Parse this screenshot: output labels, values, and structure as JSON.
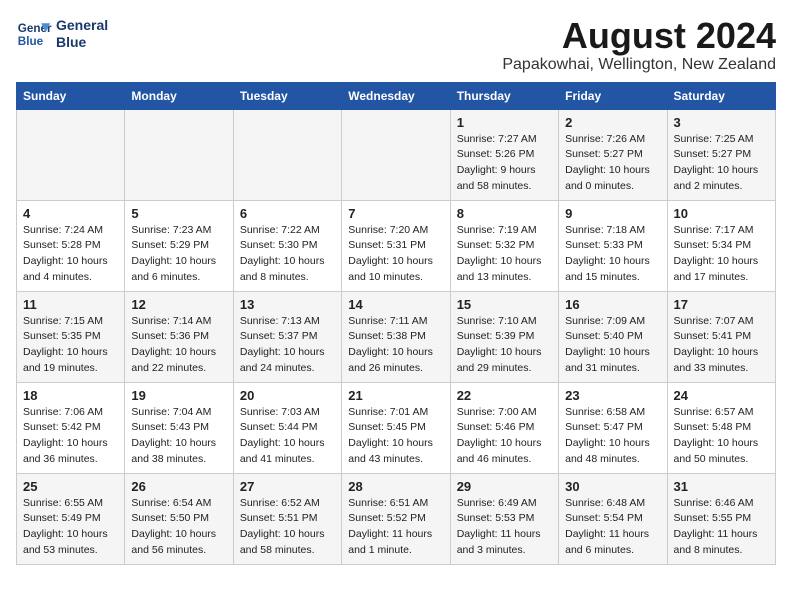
{
  "header": {
    "logo_line1": "General",
    "logo_line2": "Blue",
    "main_title": "August 2024",
    "subtitle": "Papakowhai, Wellington, New Zealand"
  },
  "calendar": {
    "days_of_week": [
      "Sunday",
      "Monday",
      "Tuesday",
      "Wednesday",
      "Thursday",
      "Friday",
      "Saturday"
    ],
    "weeks": [
      [
        {
          "day": "",
          "info": ""
        },
        {
          "day": "",
          "info": ""
        },
        {
          "day": "",
          "info": ""
        },
        {
          "day": "",
          "info": ""
        },
        {
          "day": "1",
          "info": "Sunrise: 7:27 AM\nSunset: 5:26 PM\nDaylight: 9 hours\nand 58 minutes."
        },
        {
          "day": "2",
          "info": "Sunrise: 7:26 AM\nSunset: 5:27 PM\nDaylight: 10 hours\nand 0 minutes."
        },
        {
          "day": "3",
          "info": "Sunrise: 7:25 AM\nSunset: 5:27 PM\nDaylight: 10 hours\nand 2 minutes."
        }
      ],
      [
        {
          "day": "4",
          "info": "Sunrise: 7:24 AM\nSunset: 5:28 PM\nDaylight: 10 hours\nand 4 minutes."
        },
        {
          "day": "5",
          "info": "Sunrise: 7:23 AM\nSunset: 5:29 PM\nDaylight: 10 hours\nand 6 minutes."
        },
        {
          "day": "6",
          "info": "Sunrise: 7:22 AM\nSunset: 5:30 PM\nDaylight: 10 hours\nand 8 minutes."
        },
        {
          "day": "7",
          "info": "Sunrise: 7:20 AM\nSunset: 5:31 PM\nDaylight: 10 hours\nand 10 minutes."
        },
        {
          "day": "8",
          "info": "Sunrise: 7:19 AM\nSunset: 5:32 PM\nDaylight: 10 hours\nand 13 minutes."
        },
        {
          "day": "9",
          "info": "Sunrise: 7:18 AM\nSunset: 5:33 PM\nDaylight: 10 hours\nand 15 minutes."
        },
        {
          "day": "10",
          "info": "Sunrise: 7:17 AM\nSunset: 5:34 PM\nDaylight: 10 hours\nand 17 minutes."
        }
      ],
      [
        {
          "day": "11",
          "info": "Sunrise: 7:15 AM\nSunset: 5:35 PM\nDaylight: 10 hours\nand 19 minutes."
        },
        {
          "day": "12",
          "info": "Sunrise: 7:14 AM\nSunset: 5:36 PM\nDaylight: 10 hours\nand 22 minutes."
        },
        {
          "day": "13",
          "info": "Sunrise: 7:13 AM\nSunset: 5:37 PM\nDaylight: 10 hours\nand 24 minutes."
        },
        {
          "day": "14",
          "info": "Sunrise: 7:11 AM\nSunset: 5:38 PM\nDaylight: 10 hours\nand 26 minutes."
        },
        {
          "day": "15",
          "info": "Sunrise: 7:10 AM\nSunset: 5:39 PM\nDaylight: 10 hours\nand 29 minutes."
        },
        {
          "day": "16",
          "info": "Sunrise: 7:09 AM\nSunset: 5:40 PM\nDaylight: 10 hours\nand 31 minutes."
        },
        {
          "day": "17",
          "info": "Sunrise: 7:07 AM\nSunset: 5:41 PM\nDaylight: 10 hours\nand 33 minutes."
        }
      ],
      [
        {
          "day": "18",
          "info": "Sunrise: 7:06 AM\nSunset: 5:42 PM\nDaylight: 10 hours\nand 36 minutes."
        },
        {
          "day": "19",
          "info": "Sunrise: 7:04 AM\nSunset: 5:43 PM\nDaylight: 10 hours\nand 38 minutes."
        },
        {
          "day": "20",
          "info": "Sunrise: 7:03 AM\nSunset: 5:44 PM\nDaylight: 10 hours\nand 41 minutes."
        },
        {
          "day": "21",
          "info": "Sunrise: 7:01 AM\nSunset: 5:45 PM\nDaylight: 10 hours\nand 43 minutes."
        },
        {
          "day": "22",
          "info": "Sunrise: 7:00 AM\nSunset: 5:46 PM\nDaylight: 10 hours\nand 46 minutes."
        },
        {
          "day": "23",
          "info": "Sunrise: 6:58 AM\nSunset: 5:47 PM\nDaylight: 10 hours\nand 48 minutes."
        },
        {
          "day": "24",
          "info": "Sunrise: 6:57 AM\nSunset: 5:48 PM\nDaylight: 10 hours\nand 50 minutes."
        }
      ],
      [
        {
          "day": "25",
          "info": "Sunrise: 6:55 AM\nSunset: 5:49 PM\nDaylight: 10 hours\nand 53 minutes."
        },
        {
          "day": "26",
          "info": "Sunrise: 6:54 AM\nSunset: 5:50 PM\nDaylight: 10 hours\nand 56 minutes."
        },
        {
          "day": "27",
          "info": "Sunrise: 6:52 AM\nSunset: 5:51 PM\nDaylight: 10 hours\nand 58 minutes."
        },
        {
          "day": "28",
          "info": "Sunrise: 6:51 AM\nSunset: 5:52 PM\nDaylight: 11 hours\nand 1 minute."
        },
        {
          "day": "29",
          "info": "Sunrise: 6:49 AM\nSunset: 5:53 PM\nDaylight: 11 hours\nand 3 minutes."
        },
        {
          "day": "30",
          "info": "Sunrise: 6:48 AM\nSunset: 5:54 PM\nDaylight: 11 hours\nand 6 minutes."
        },
        {
          "day": "31",
          "info": "Sunrise: 6:46 AM\nSunset: 5:55 PM\nDaylight: 11 hours\nand 8 minutes."
        }
      ]
    ]
  }
}
